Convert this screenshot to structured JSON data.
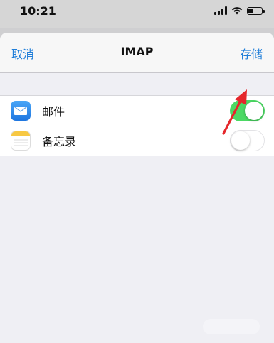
{
  "status_bar": {
    "time": "10:21",
    "battery_level": 0.35
  },
  "nav": {
    "cancel_label": "取消",
    "title": "IMAP",
    "save_label": "存储"
  },
  "apps": [
    {
      "label": "邮件",
      "icon": "mail-app-icon",
      "enabled": true
    },
    {
      "label": "备忘录",
      "icon": "notes-app-icon",
      "enabled": false
    }
  ],
  "colors": {
    "accent": "#1f7ed9",
    "toggle_on": "#4cd964",
    "annotation_arrow": "#e5262b"
  }
}
